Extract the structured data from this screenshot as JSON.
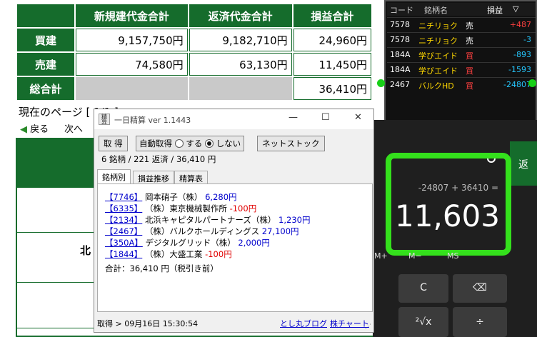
{
  "summary_table": {
    "headers": [
      "新規建代金合計",
      "返済代金合計",
      "損益合計"
    ],
    "rows": [
      {
        "label": "買建",
        "values": [
          "9,157,750円",
          "9,182,710円",
          "24,960円"
        ]
      },
      {
        "label": "売建",
        "values": [
          "74,580円",
          "63,130円",
          "11,450円"
        ]
      },
      {
        "label": "総合計",
        "values": [
          "",
          "",
          "36,410円"
        ]
      }
    ]
  },
  "page_info": "現在のページ [ 1/1 ]",
  "nav": {
    "back": "戻る",
    "next": "次へ"
  },
  "bg_fragment": "北",
  "stock_widget": {
    "headers": {
      "code": "コード",
      "name": "銘柄名",
      "pl": "損益",
      "sort": "▽"
    },
    "rows": [
      {
        "code": "7578",
        "name": "ニチリョク",
        "side": "売",
        "pl": "+487",
        "positive": true
      },
      {
        "code": "7578",
        "name": "ニチリョク",
        "side": "売",
        "pl": "-3",
        "positive": false
      },
      {
        "code": "184A",
        "name": "学びエイド",
        "side": "買",
        "pl": "-893",
        "positive": false
      },
      {
        "code": "184A",
        "name": "学びエイド",
        "side": "買",
        "pl": "-1593",
        "positive": false
      },
      {
        "code": "2467",
        "name": "バルクHD",
        "side": "買",
        "pl": "-24807",
        "positive": false
      }
    ]
  },
  "calculator": {
    "expression": "-24807 + 36410 =",
    "result": "11,603",
    "memory_keys": [
      "M+",
      "M−",
      "MS"
    ],
    "keys": [
      "C",
      "⌫",
      "²√x",
      "÷"
    ],
    "side_tab": "返"
  },
  "dialog": {
    "icon_text": "精算",
    "title": "一日精算 ver 1.1443",
    "win_controls": {
      "min": "—",
      "max": "☐",
      "close": "✕"
    },
    "toolbar": {
      "fetch": "取 得",
      "auto_label": "自動取得",
      "opt_on": "する",
      "opt_off": "しない",
      "netstock": "ネットストック"
    },
    "summary": "6 銘柄 / 221 返済 / 36,410 円",
    "tabs": [
      "銘柄別",
      "損益推移",
      "精算表"
    ],
    "items": [
      {
        "code": "【7746】",
        "name": "岡本硝子（株）",
        "amount": "6,280円",
        "positive": true
      },
      {
        "code": "【6335】",
        "name": "（株）東京機械製作所",
        "amount": "-100円",
        "positive": false
      },
      {
        "code": "【2134】",
        "name": "北浜キャピタルパートナーズ（株）",
        "amount": "1,230円",
        "positive": true
      },
      {
        "code": "【2467】",
        "name": "（株）バルクホールディングス",
        "amount": "27,100円",
        "positive": true
      },
      {
        "code": "【350A】",
        "name": "デジタルグリッド（株）",
        "amount": "2,000円",
        "positive": true
      },
      {
        "code": "【1844】",
        "name": "（株）大盛工業",
        "amount": "-100円",
        "positive": false
      }
    ],
    "total": "合計：36,410 円（税引き前）",
    "status": "取得 > 09月16日 15:30:54",
    "links": [
      "とし丸ブログ",
      "株チャート"
    ]
  }
}
